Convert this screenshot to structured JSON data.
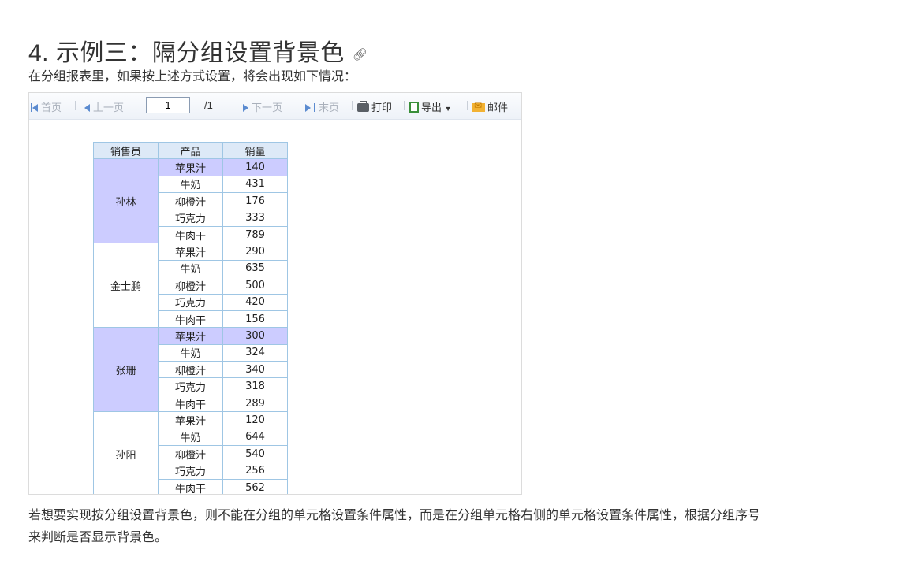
{
  "heading": {
    "text": "4. 示例三：隔分组设置背景色",
    "link_icon": "link-icon"
  },
  "intro": "在分组报表里，如果按上述方式设置，将会出现如下情况：",
  "toolbar": {
    "first": "首页",
    "prev": "上一页",
    "page_value": "1",
    "page_total": "/1",
    "next": "下一页",
    "last": "末页",
    "print": "打印",
    "export": "导出",
    "mail": "邮件"
  },
  "table": {
    "headers": [
      "销售员",
      "产品",
      "销量"
    ],
    "highlight_color": "#ccccff",
    "groups": [
      {
        "name": "孙林",
        "highlight": true,
        "rows": [
          {
            "product": "苹果汁",
            "qty": "140"
          },
          {
            "product": "牛奶",
            "qty": "431"
          },
          {
            "product": "柳橙汁",
            "qty": "176"
          },
          {
            "product": "巧克力",
            "qty": "333"
          },
          {
            "product": "牛肉干",
            "qty": "789"
          }
        ]
      },
      {
        "name": "金士鹏",
        "highlight": false,
        "rows": [
          {
            "product": "苹果汁",
            "qty": "290"
          },
          {
            "product": "牛奶",
            "qty": "635"
          },
          {
            "product": "柳橙汁",
            "qty": "500"
          },
          {
            "product": "巧克力",
            "qty": "420"
          },
          {
            "product": "牛肉干",
            "qty": "156"
          }
        ]
      },
      {
        "name": "张珊",
        "highlight": true,
        "rows": [
          {
            "product": "苹果汁",
            "qty": "300"
          },
          {
            "product": "牛奶",
            "qty": "324"
          },
          {
            "product": "柳橙汁",
            "qty": "340"
          },
          {
            "product": "巧克力",
            "qty": "318"
          },
          {
            "product": "牛肉干",
            "qty": "289"
          }
        ]
      },
      {
        "name": "孙阳",
        "highlight": false,
        "rows": [
          {
            "product": "苹果汁",
            "qty": "120"
          },
          {
            "product": "牛奶",
            "qty": "644"
          },
          {
            "product": "柳橙汁",
            "qty": "540"
          },
          {
            "product": "巧克力",
            "qty": "256"
          },
          {
            "product": "牛肉干",
            "qty": "562"
          }
        ]
      }
    ]
  },
  "paragraph": {
    "line1": "若想要实现按分组设置背景色，则不能在分组的单元格设置条件属性，而是在分组单元格右侧的单元格设置条件属性，根据分组序号",
    "line2": "来判断是否显示背景色。"
  }
}
